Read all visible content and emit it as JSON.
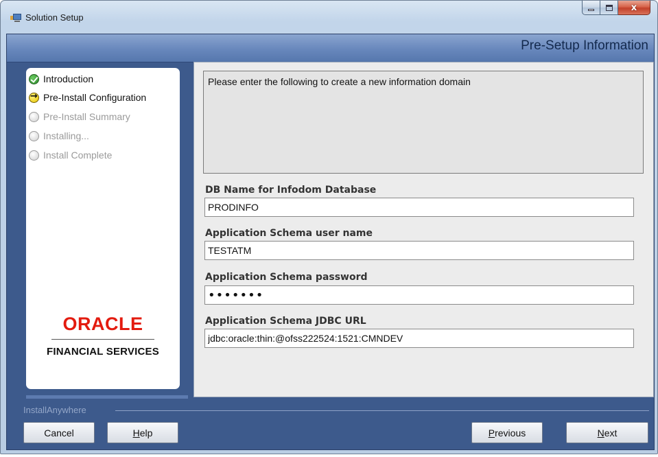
{
  "window": {
    "title": "Solution Setup",
    "controls": {
      "minimize": "minimize",
      "maximize": "maximize",
      "close": "x"
    }
  },
  "header": {
    "title": "Pre-Setup Information"
  },
  "steps": [
    {
      "label": "Introduction",
      "state": "done",
      "icon": "check-icon"
    },
    {
      "label": "Pre-Install Configuration",
      "state": "current",
      "icon": "arrow-icon"
    },
    {
      "label": "Pre-Install Summary",
      "state": "pending",
      "icon": "empty-circle-icon"
    },
    {
      "label": "Installing...",
      "state": "pending",
      "icon": "empty-circle-icon"
    },
    {
      "label": "Install Complete",
      "state": "pending",
      "icon": "empty-circle-icon"
    }
  ],
  "branding": {
    "logo_text": "ORACLE",
    "subtitle": "FINANCIAL SERVICES",
    "logo_color": "#e31b0f"
  },
  "main": {
    "description": "Please enter the following to create a new information domain",
    "fields": [
      {
        "label": "DB Name for Infodom Database",
        "value": "PRODINFO"
      },
      {
        "label": "Application Schema user name",
        "value": "TESTATM"
      },
      {
        "label": "Application Schema password",
        "value": "•••••••"
      },
      {
        "label": "Application Schema JDBC URL",
        "value": "jdbc:oracle:thin:@ofss222524:1521:CMNDEV"
      }
    ]
  },
  "footer": {
    "brand": "InstallAnywhere",
    "buttons": {
      "cancel": "Cancel",
      "help_first": "H",
      "help_rest": "elp",
      "previous_first": "P",
      "previous_rest": "revious",
      "next_first": "N",
      "next_rest": "ext"
    }
  },
  "colors": {
    "header_band": "#6887bc",
    "client_bg": "#3d5a8c",
    "close_button": "#c2412a"
  }
}
